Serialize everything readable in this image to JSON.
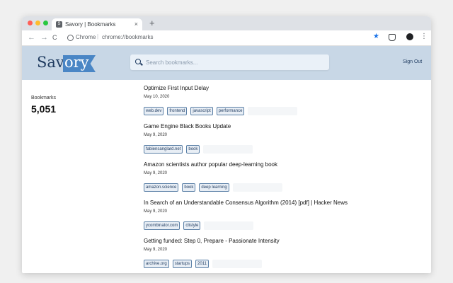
{
  "browser": {
    "tab_title": "Savory | Bookmarks",
    "favicon_letter": "S",
    "tab_close": "×",
    "new_tab": "+",
    "back": "←",
    "forward": "→",
    "reload": "C",
    "omnibox_label": "Chrome",
    "omnibox_separator": "|",
    "url": "chrome://bookmarks",
    "star": "★",
    "menu": "⋮"
  },
  "header": {
    "logo_part1": "Sav",
    "logo_part2": "ory",
    "search_placeholder": "Search bookmarks...",
    "sign_out": "Sign Out"
  },
  "stats": {
    "label": "Bookmarks",
    "value": "5,051"
  },
  "bookmarks": [
    {
      "title": "Optimize First Input Delay",
      "date": "May 10, 2020",
      "tags": [
        "web.dev",
        "frontend",
        "javascript",
        "performance"
      ]
    },
    {
      "title": "Game Engine Black Books Update",
      "date": "May 9, 2020",
      "tags": [
        "fabiensanglard.net",
        "book"
      ]
    },
    {
      "title": "Amazon scientists author popular deep-learning book",
      "date": "May 9, 2020",
      "tags": [
        "amazon.science",
        "book",
        "deep learning"
      ]
    },
    {
      "title": "In Search of an Understandable Consensus Algorithm (2014) [pdf] | Hacker News",
      "date": "May 9, 2020",
      "tags": [
        "ycombinator.com",
        "clistyle"
      ]
    },
    {
      "title": "Getting funded: Step 0, Prepare - Passionate Intensity",
      "date": "May 9, 2020",
      "tags": [
        "archive.org",
        "startups",
        "2011"
      ]
    }
  ]
}
